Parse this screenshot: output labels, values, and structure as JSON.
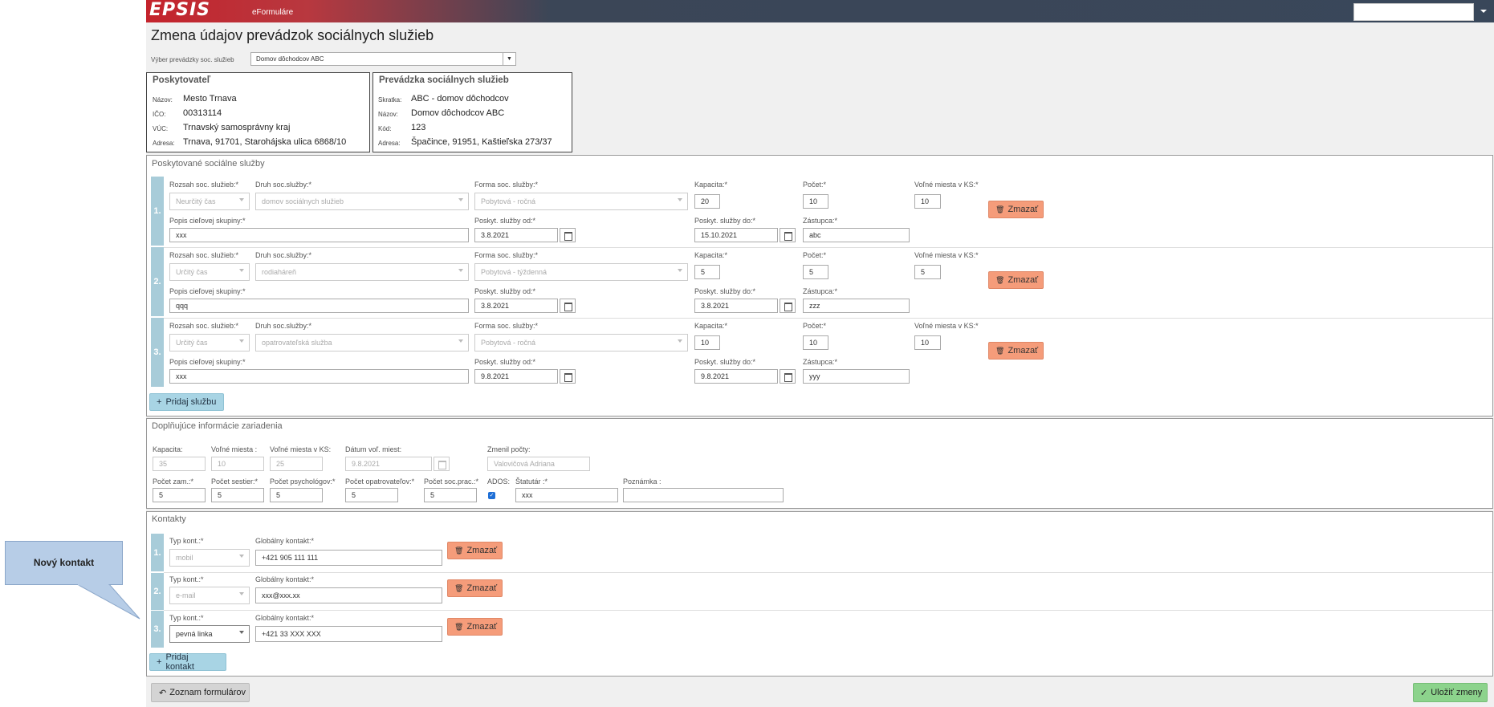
{
  "header": {
    "logo": "EPSIS",
    "app_name": "eFormuláre",
    "user_value": ""
  },
  "page": {
    "title": "Zmena údajov prevádzok sociálnych služieb"
  },
  "selector": {
    "label": "Výber prevádzky soc. služieb",
    "value": "Domov dôchodcov ABC",
    "button": "▼"
  },
  "provider": {
    "title": "Poskytovateľ",
    "rows": [
      {
        "label": "Názov:",
        "value": "Mesto Trnava"
      },
      {
        "label": "IČO:",
        "value": "00313114"
      },
      {
        "label": "VÚC:",
        "value": "Trnavský samosprávny kraj"
      },
      {
        "label": "Adresa:",
        "value": "Trnava, 91701, Starohájska ulica 6868/10"
      }
    ]
  },
  "facility": {
    "title": "Prevádzka sociálnych služieb",
    "rows": [
      {
        "label": "Skratka:",
        "value": "ABC - domov dôchodcov"
      },
      {
        "label": "Názov:",
        "value": "Domov dôchodcov ABC"
      },
      {
        "label": "Kód:",
        "value": "123"
      },
      {
        "label": "Adresa:",
        "value": "Špačince, 91951, Kaštieľska 273/37"
      }
    ]
  },
  "services": {
    "title": "Poskytované sociálne služby",
    "labels": {
      "rozsah": "Rozsah soc. služieb:*",
      "druh": "Druh soc.služby:*",
      "forma": "Forma soc. služby:*",
      "kapacita": "Kapacita:*",
      "pocet": "Počet:*",
      "volne": "Voľné miesta v KS:*",
      "popis": "Popis cieľovej skupiny:*",
      "od": "Poskyt. služby od:*",
      "do": "Poskyt. služby do:*",
      "zastupca": "Zástupca:*"
    },
    "rows": [
      {
        "num": "1.",
        "rozsah": "Neurčitý čas",
        "druh": "domov sociálnych služieb",
        "forma": "Pobytová - ročná",
        "kapacita": "20",
        "pocet": "10",
        "volne": "10",
        "popis": "xxx",
        "od": "3.8.2021",
        "do": "15.10.2021",
        "zastupca": "abc",
        "delete": "Zmazať"
      },
      {
        "num": "2.",
        "rozsah": "Určitý čas",
        "druh": "rodiaháreň",
        "forma": "Pobytová - týždenná",
        "kapacita": "5",
        "pocet": "5",
        "volne": "5",
        "popis": "qqq",
        "od": "3.8.2021",
        "do": "3.8.2021",
        "zastupca": "zzz",
        "delete": "Zmazať"
      },
      {
        "num": "3.",
        "rozsah": "Určitý čas",
        "druh": "opatrovateľská služba",
        "forma": "Pobytová - ročná",
        "kapacita": "10",
        "pocet": "10",
        "volne": "10",
        "popis": "xxx",
        "od": "9.8.2021",
        "do": "9.8.2021",
        "zastupca": "yyy",
        "delete": "Zmazať"
      }
    ],
    "add_label": "Pridaj službu"
  },
  "extra": {
    "title": "Doplňujúce informácie zariadenia",
    "kapacita": {
      "label": "Kapacita:",
      "value": "35"
    },
    "volne": {
      "label": "Voľné miesta :",
      "value": "10"
    },
    "volne_ks": {
      "label": "Voľné miesta v KS:",
      "value": "25"
    },
    "datum": {
      "label": "Dátum voľ. miest:",
      "value": "9.8.2021"
    },
    "zmenil": {
      "label": "Zmenil počty:",
      "value": "Valovičová Adriana"
    },
    "zam": {
      "label": "Počet zam.:*",
      "value": "5"
    },
    "sestier": {
      "label": "Počet sestier:*",
      "value": "5"
    },
    "psych": {
      "label": "Počet psychológov:*",
      "value": "5"
    },
    "opatr": {
      "label": "Počet opatrovateľov:*",
      "value": "5"
    },
    "socprac": {
      "label": "Počet soc.prac.:*",
      "value": "5"
    },
    "ados": {
      "label": "ADOS:",
      "checked": true
    },
    "statutar": {
      "label": "Štatutár :*",
      "value": "xxx"
    },
    "poznamka": {
      "label": "Poznámka :",
      "value": ""
    }
  },
  "contacts": {
    "title": "Kontakty",
    "labels": {
      "typ": "Typ kont.:*",
      "global": "Globálny kontakt:*"
    },
    "rows": [
      {
        "num": "1.",
        "typ": "mobil",
        "value": "+421 905 111 111",
        "delete": "Zmazať"
      },
      {
        "num": "2.",
        "typ": "e-mail",
        "value": "xxx@xxx.xx",
        "delete": "Zmazať"
      },
      {
        "num": "3.",
        "typ": "pevná linka",
        "value": "+421 33 XXX XXX",
        "delete": "Zmazať"
      }
    ],
    "add_label": "Pridaj kontakt"
  },
  "footer": {
    "back_label": "Zoznam formulárov",
    "save_label": "Uložiť zmeny"
  },
  "tooltip": {
    "text": "Nový kontakt"
  },
  "colors": {
    "accent_red": "#c4232c",
    "header_dark": "#39475a",
    "delete": "#f59c7a",
    "add": "#a8d4e4",
    "save": "#8cd38c",
    "row_bar": "#a8ccd9"
  }
}
